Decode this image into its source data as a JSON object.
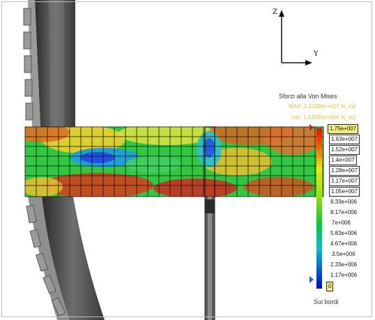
{
  "axes": {
    "z_label": "Z",
    "y_label": "Y"
  },
  "legend": {
    "title": "Sforzi alla Von Mises",
    "max_text": "MAX: 2.41086e+007 N_m2",
    "min_text": "min: 1.03565e+006 N_m2",
    "ticks": [
      "1.75e+007",
      "1.63e+007",
      "1.52e+007",
      "1.4e+007",
      "1.28e+007",
      "1.17e+007",
      "1.05e+007",
      "9.33e+006",
      "8.17e+006",
      "7e+006",
      "5.83e+006",
      "4.67e+006",
      "3.5e+006",
      "2.33e+006",
      "1.17e+006",
      "0"
    ],
    "footer": "Sui bordi"
  },
  "colors": {
    "max_text": "#e0c040",
    "gradient_top": "#ff0000",
    "gradient_mid": "#00cc33",
    "gradient_bottom": "#0000c8"
  }
}
